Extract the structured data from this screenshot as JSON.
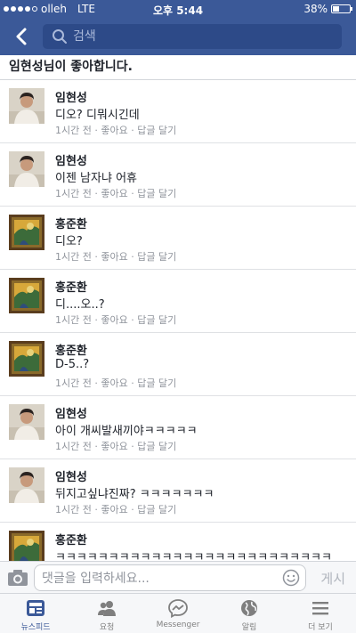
{
  "status": {
    "carrier": "olleh",
    "network": "LTE",
    "time": "오후 5:44",
    "battery_label": "38%",
    "battery_level": 0.38
  },
  "header": {
    "search_placeholder": "검색"
  },
  "likes_line": "임현성님이 좋아합니다.",
  "comments": [
    {
      "name": "임현성",
      "text": "디오? 디뭐시긴데",
      "time": "1시간 전",
      "like": "좋아요",
      "reply": "답글 달기",
      "sep": " · ",
      "avatar": "person"
    },
    {
      "name": "임현성",
      "text": "이젠 남자냐 어휴",
      "time": "1시간 전",
      "like": "좋아요",
      "reply": "답글 달기",
      "sep": " · ",
      "avatar": "person"
    },
    {
      "name": "홍준환",
      "text": "디오?",
      "time": "1시간 전",
      "like": "좋아요",
      "reply": "답글 달기",
      "sep": " · ",
      "avatar": "painting"
    },
    {
      "name": "홍준환",
      "text": "디....오..?",
      "time": "1시간 전",
      "like": "좋아요",
      "reply": "답글 달기",
      "sep": " · ",
      "avatar": "painting"
    },
    {
      "name": "홍준환",
      "text": "D-5..?",
      "time": "1시간 전",
      "like": "좋아요",
      "reply": "답글 달기",
      "sep": " · ",
      "avatar": "painting"
    },
    {
      "name": "임현성",
      "text": "아이 개씨발새끼야ㅋㅋㅋㅋㅋ",
      "time": "1시간 전",
      "like": "좋아요",
      "reply": "답글 달기",
      "sep": " · ",
      "avatar": "person"
    },
    {
      "name": "임현성",
      "text": "뒤지고싶냐진짜? ㅋㅋㅋㅋㅋㅋㅋ",
      "time": "1시간 전",
      "like": "좋아요",
      "reply": "답글 달기",
      "sep": " · ",
      "avatar": "person"
    },
    {
      "name": "홍준환",
      "text": "ㅋㅋㅋㅋㅋㅋㅋㅋㅋㅋㅋㅋㅋㅋㅋㅋㅋㅋㅋㅋㅋㅋㅋㅋㅋㅋ",
      "time": "",
      "like": "",
      "reply": "",
      "sep": "",
      "avatar": "painting"
    }
  ],
  "composer": {
    "placeholder": "댓글을 입력하세요...",
    "post_label": "게시"
  },
  "tabs": [
    {
      "label": "뉴스피드",
      "icon": "newsfeed-icon",
      "active": true
    },
    {
      "label": "요청",
      "icon": "friend-requests-icon",
      "active": false
    },
    {
      "label": "Messenger",
      "icon": "messenger-icon",
      "active": false
    },
    {
      "label": "알림",
      "icon": "notifications-globe-icon",
      "active": false
    },
    {
      "label": "더 보기",
      "icon": "menu-icon",
      "active": false
    }
  ],
  "colors": {
    "brand": "#3b5998",
    "meta_text": "#90949c"
  }
}
